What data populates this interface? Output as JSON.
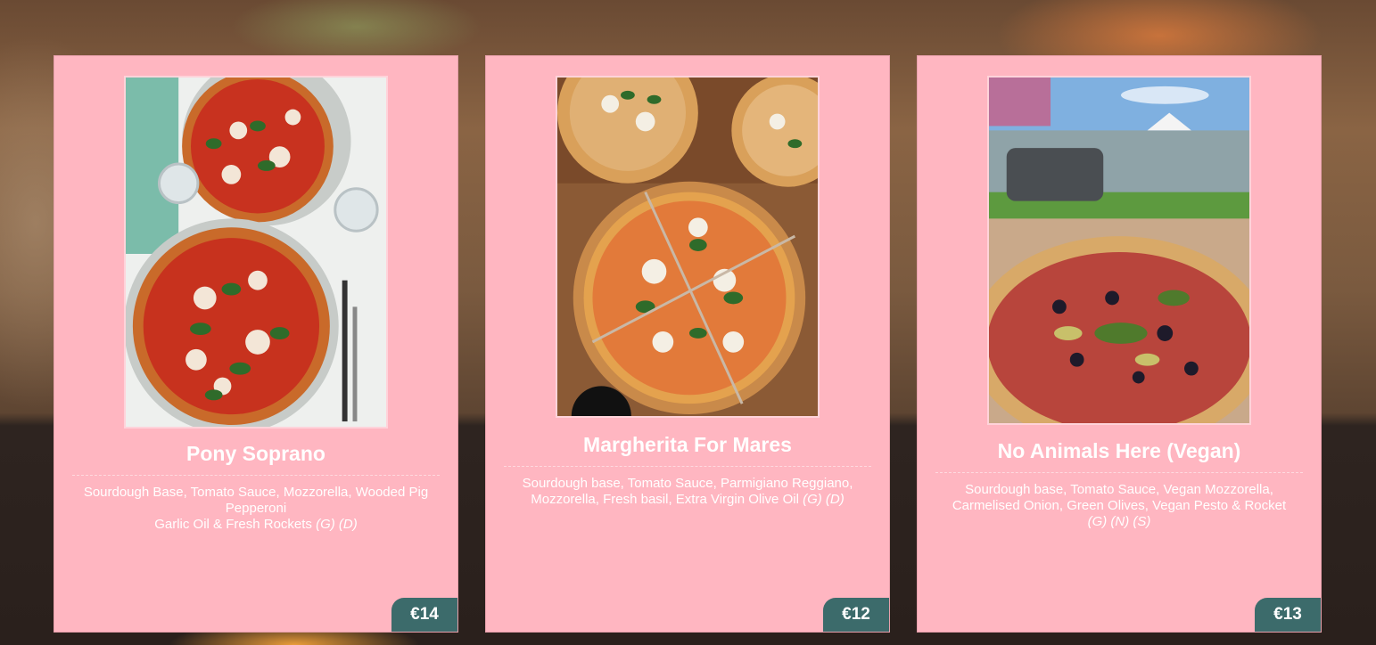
{
  "menu": {
    "items": [
      {
        "name": "Pony Soprano",
        "description_line1": "Sourdough Base, Tomato Sauce, Mozzorella, Wooded Pig Pepperoni",
        "description_line2": "Garlic Oil & Fresh Rockets",
        "tags": "(G) (D)",
        "price": "€14",
        "image_icon": "pizza-photo"
      },
      {
        "name": "Margherita For Mares",
        "description_line1": "Sourdough base, Tomato Sauce, Parmigiano Reggiano, Mozzorella, Fresh basil, Extra Virgin Olive Oil",
        "tags": "(G) (D)",
        "price": "€12",
        "image_icon": "pizza-photo"
      },
      {
        "name": "No Animals Here (Vegan)",
        "description_line1": "Sourdough base, Tomato Sauce, Vegan Mozzorella, Carmelised Onion, Green Olives, Vegan Pesto & Rocket",
        "tags": "(G) (N) (S)",
        "price": "€13",
        "image_icon": "pizza-photo"
      }
    ]
  },
  "colors": {
    "card_background": "#ffb6c1",
    "price_badge": "#3c6b6b",
    "text": "#ffffff"
  }
}
